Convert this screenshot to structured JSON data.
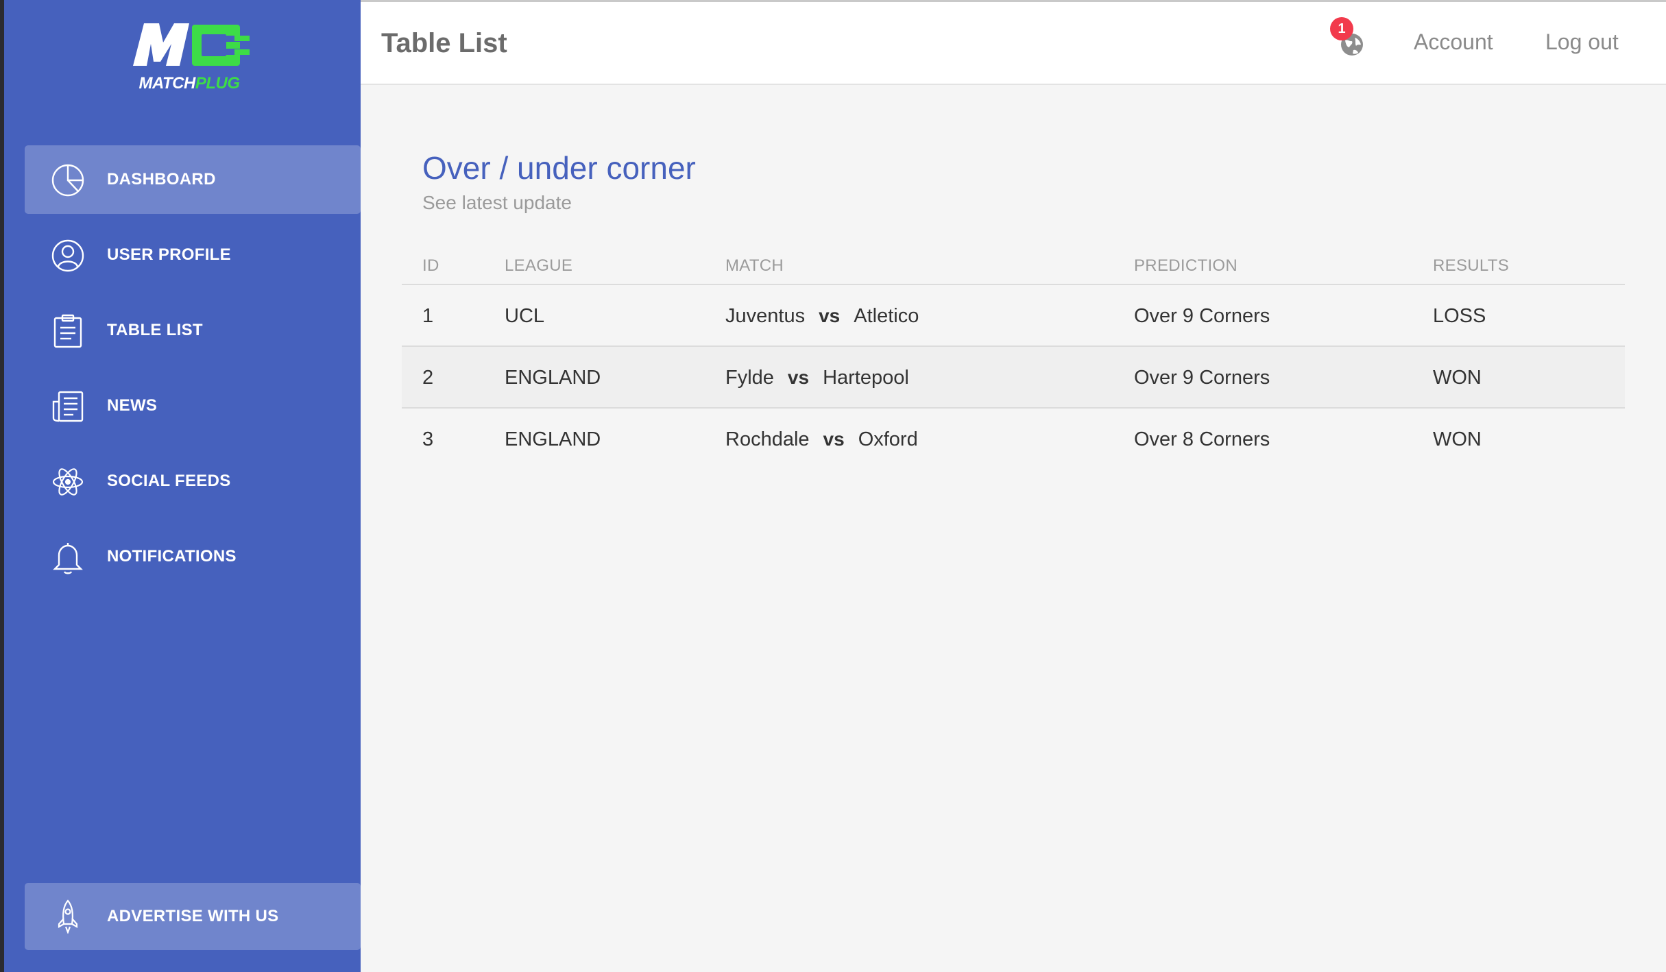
{
  "brand": {
    "logo_text_white": "MATCH",
    "logo_text_green": "PLUG",
    "sidebar_color": "#4661bd",
    "accent_green": "#3ddc47"
  },
  "sidebar": {
    "items": [
      {
        "label": "DASHBOARD",
        "icon": "pie-chart-icon",
        "active": true
      },
      {
        "label": "USER PROFILE",
        "icon": "user-icon",
        "active": false
      },
      {
        "label": "TABLE LIST",
        "icon": "clipboard-icon",
        "active": false
      },
      {
        "label": "NEWS",
        "icon": "newspaper-icon",
        "active": false
      },
      {
        "label": "SOCIAL FEEDS",
        "icon": "atom-icon",
        "active": false
      },
      {
        "label": "NOTIFICATIONS",
        "icon": "bell-icon",
        "active": false
      }
    ],
    "advertise": {
      "label": "ADVERTISE WITH US",
      "icon": "rocket-icon"
    }
  },
  "header": {
    "title": "Table List",
    "notification_count": "1",
    "globe_icon": "globe-icon",
    "account_label": "Account",
    "logout_label": "Log out"
  },
  "card": {
    "title": "Over / under corner",
    "subtitle": "See latest update",
    "columns": [
      "ID",
      "LEAGUE",
      "MATCH",
      "PREDICTION",
      "RESULTS"
    ],
    "rows": [
      {
        "id": "1",
        "league": "UCL",
        "home": "Juventus",
        "vs": "vs",
        "away": "Atletico",
        "prediction": "Over 9 Corners",
        "result": "LOSS"
      },
      {
        "id": "2",
        "league": "ENGLAND",
        "home": "Fylde",
        "vs": "vs",
        "away": "Hartepool",
        "prediction": "Over 9 Corners",
        "result": "WON"
      },
      {
        "id": "3",
        "league": "ENGLAND",
        "home": "Rochdale",
        "vs": "vs",
        "away": "Oxford",
        "prediction": "Over 8 Corners",
        "result": "WON"
      }
    ]
  }
}
